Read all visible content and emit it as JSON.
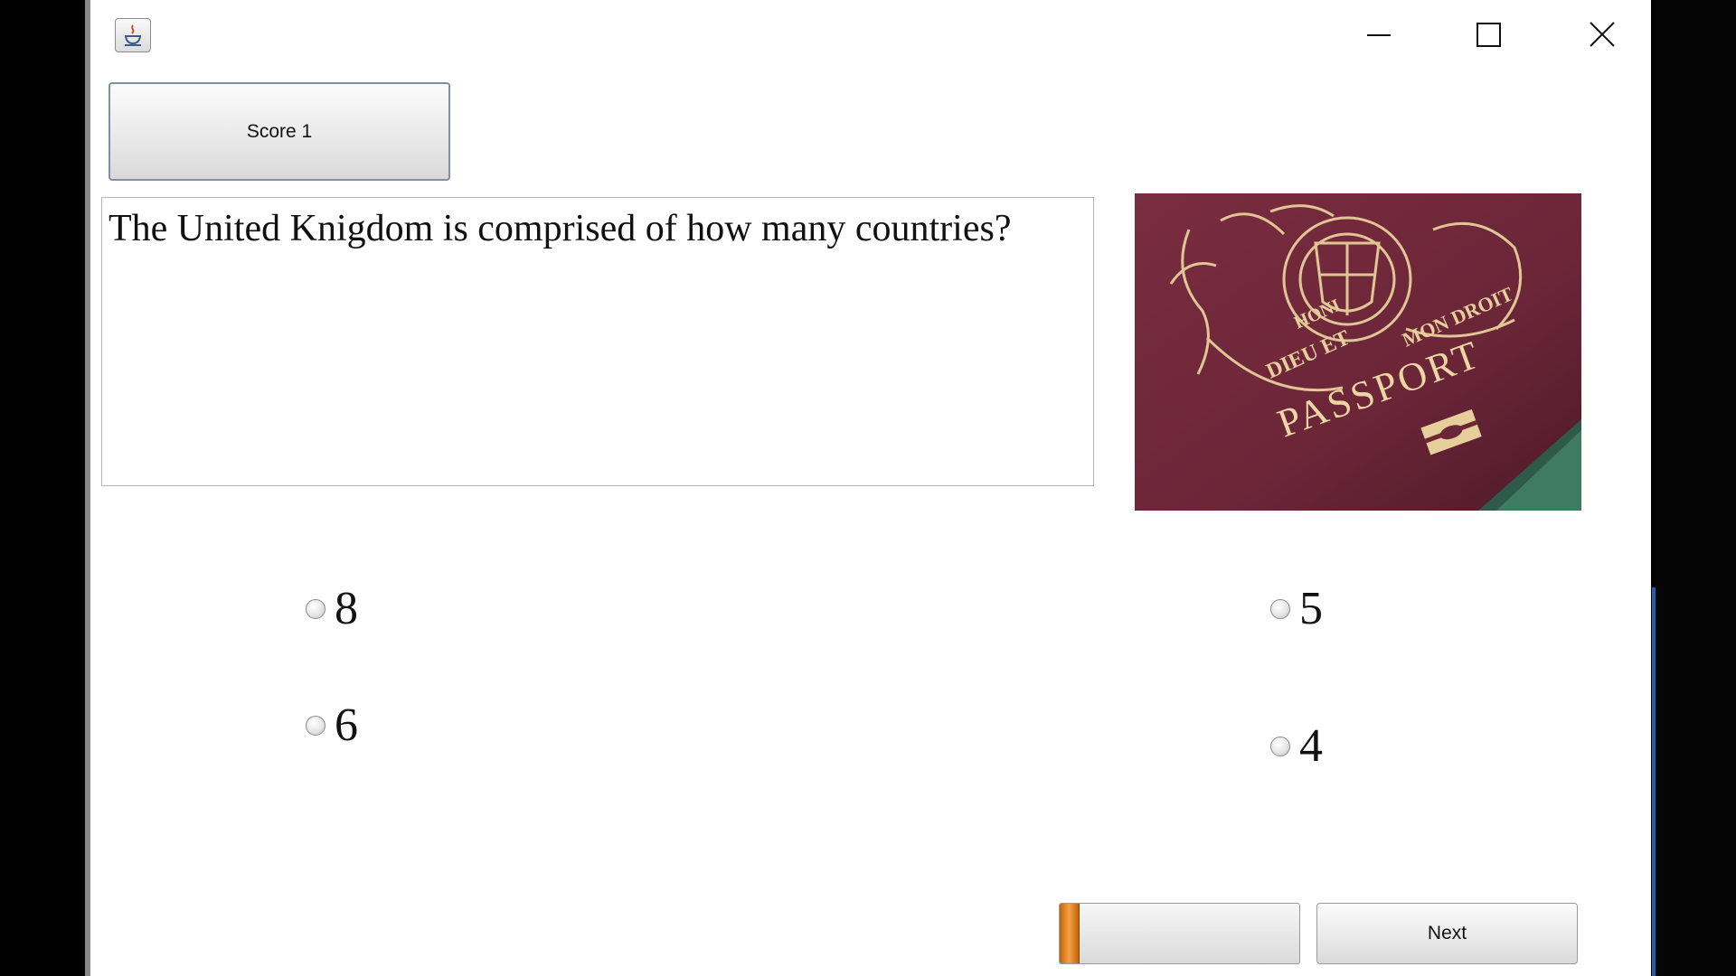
{
  "window": {
    "controls": {
      "minimize_icon": "minimize-icon",
      "maximize_icon": "maximize-icon",
      "close_icon": "close-icon"
    },
    "app_icon": "java-cup-icon"
  },
  "score": {
    "label": "Score 1"
  },
  "question": {
    "text": "The United Knigdom is comprised of how many countries?"
  },
  "image": {
    "subject": "British passport cover",
    "printed_text": [
      "PASSPORT",
      "DIEU ET",
      "MON DROIT",
      "HONI"
    ],
    "colors": {
      "cover": "#6b2638",
      "gold": "#e6cf9a"
    }
  },
  "options": [
    {
      "label": "8",
      "selected": false
    },
    {
      "label": "5",
      "selected": false
    },
    {
      "label": "6",
      "selected": false
    },
    {
      "label": "4",
      "selected": false
    }
  ],
  "progress": {
    "fraction": 0.08,
    "color": "#f08c1e"
  },
  "next": {
    "label": "Next"
  }
}
